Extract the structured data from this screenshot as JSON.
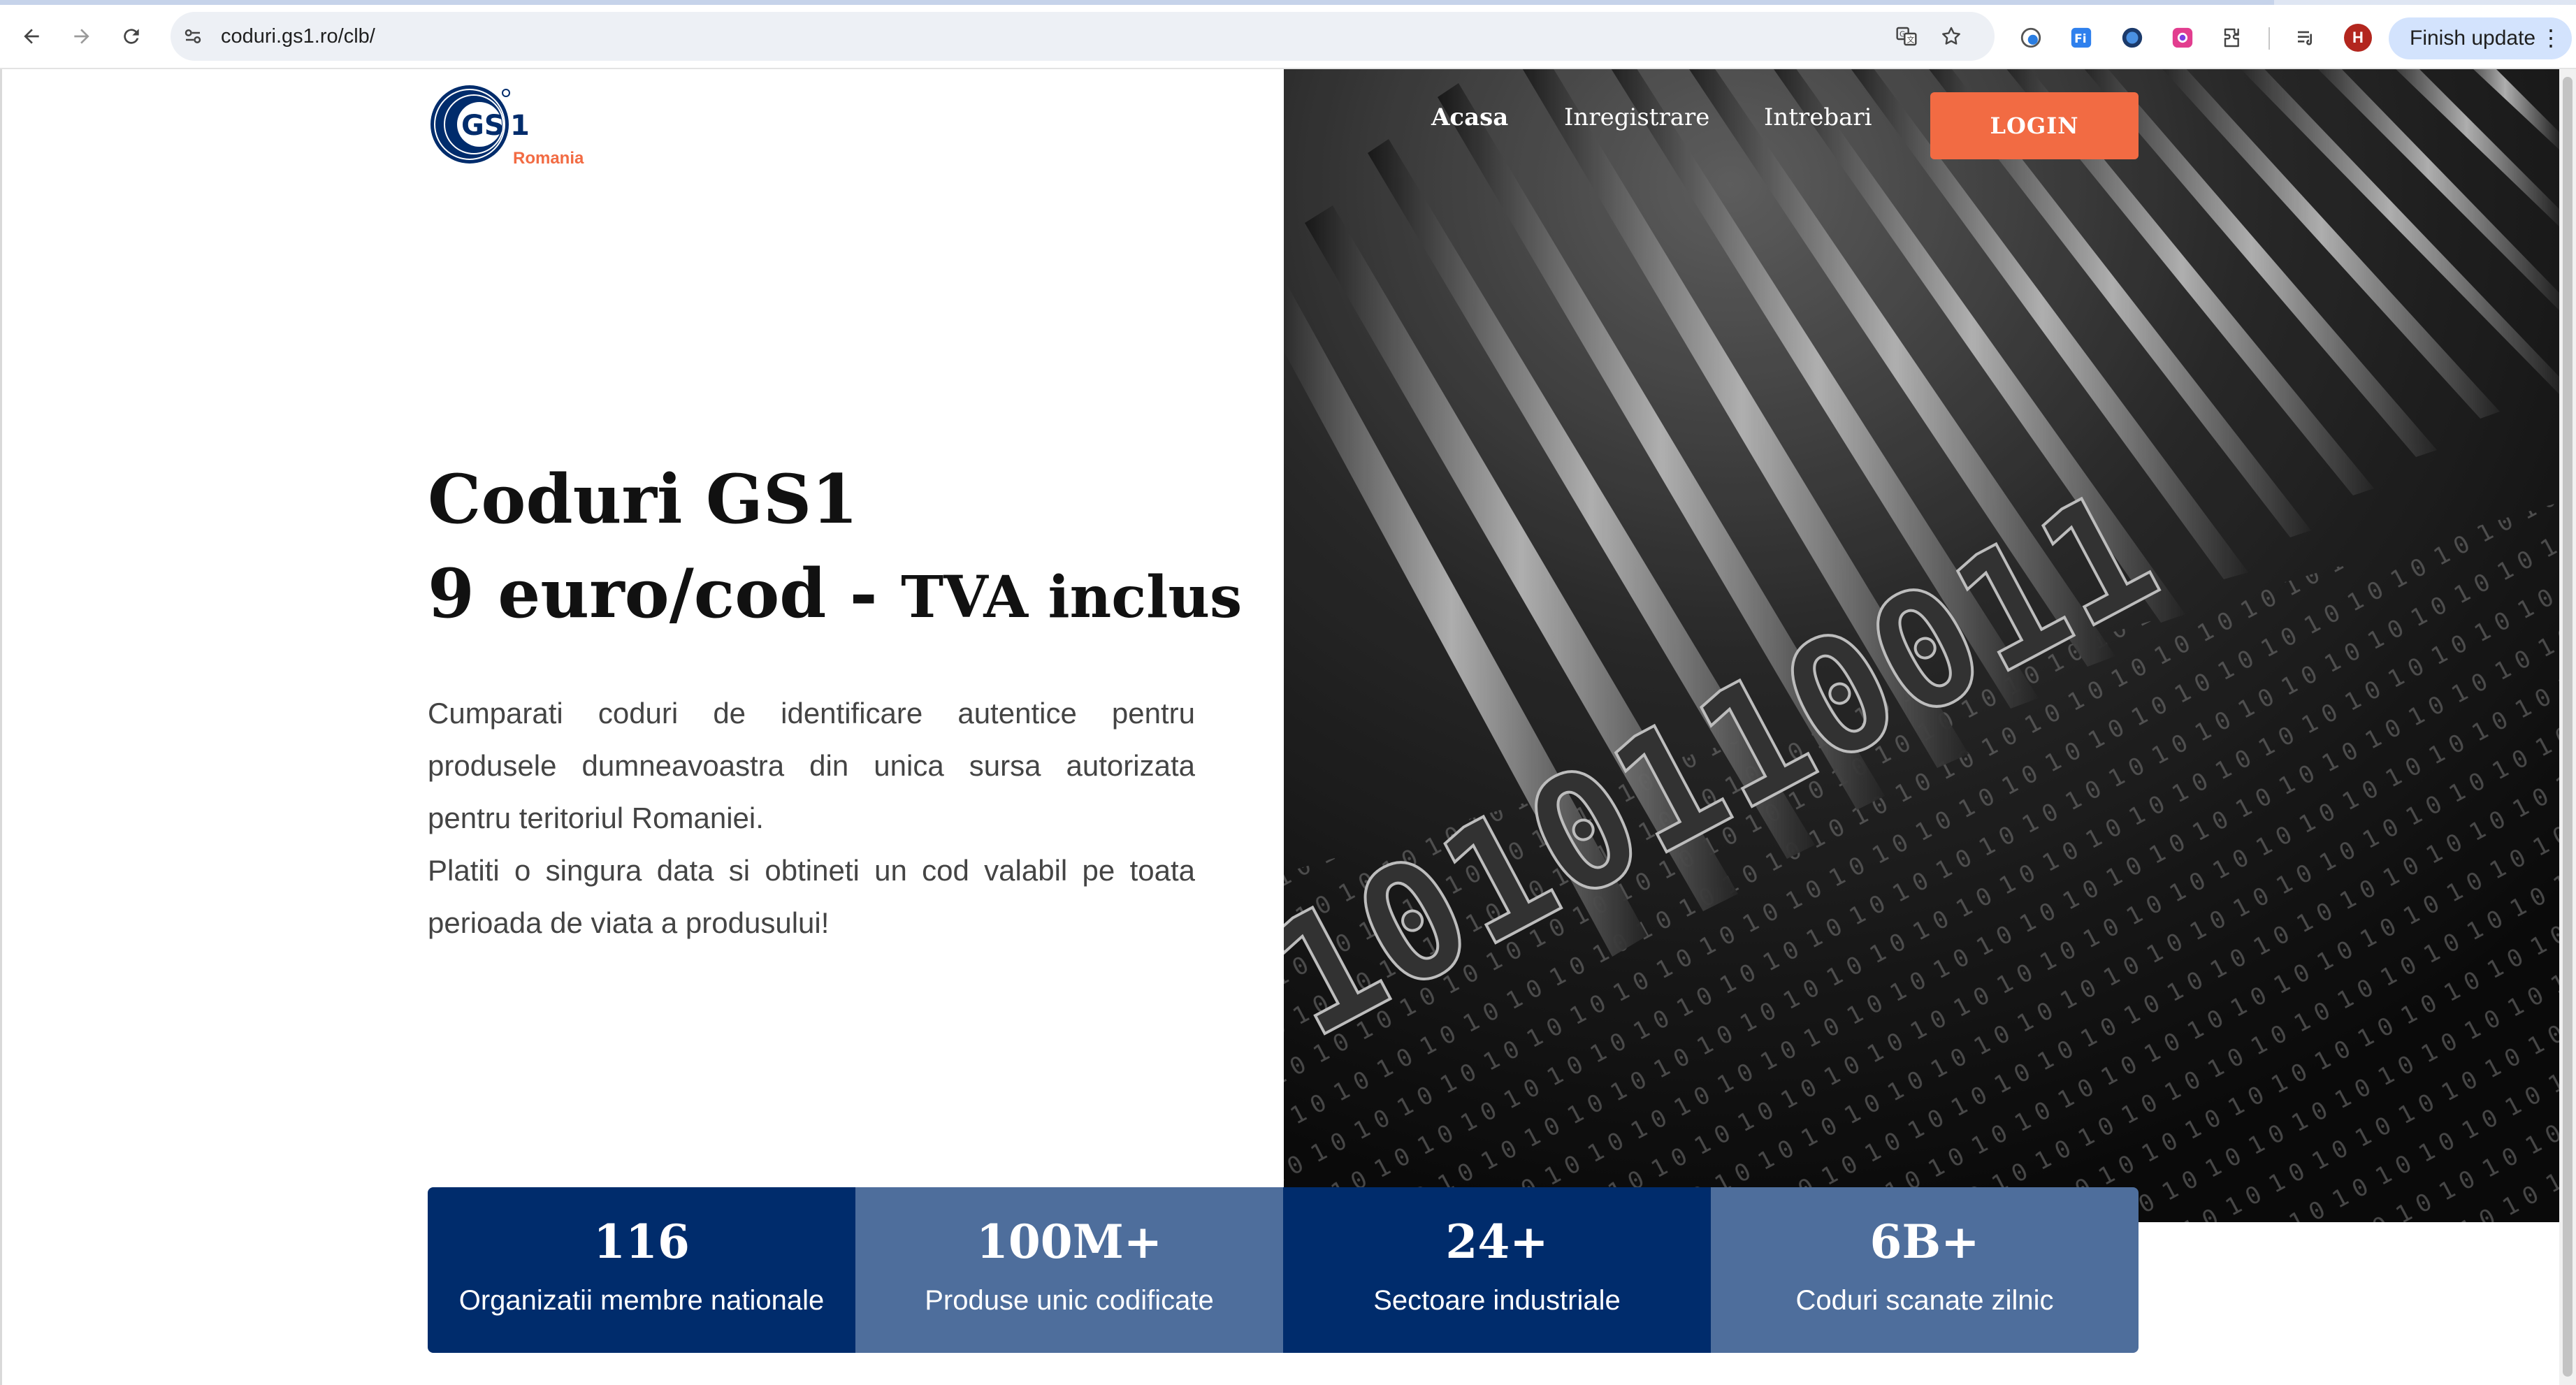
{
  "browser": {
    "url": "coduri.gs1.ro/clb/",
    "avatar_initial": "H",
    "finish_update_label": "Finish update",
    "menu_glyph": "⋮"
  },
  "site": {
    "logo_text": "GS1",
    "logo_country": "Romania",
    "brand_color": "#002c6c",
    "accent_color": "#f26b43",
    "nav": {
      "home": "Acasa",
      "register": "Inregistrare",
      "questions": "Intrebari",
      "login": "LOGIN"
    }
  },
  "hero": {
    "title_line1": "Coduri GS1",
    "title_price": "9 euro/cod -",
    "title_vat": "TVA inclus",
    "paragraph1": "Cumparati coduri de identificare autentice pentru produsele dumneavoastra din unica sursa autorizata pentru teritoriul Romaniei.",
    "paragraph2": "Platiti o singura data si obtineti un cod valabil pe toata perioada de viata a produsului!"
  },
  "stats": [
    {
      "value": "116",
      "label": "Organizatii membre nationale"
    },
    {
      "value": "100M+",
      "label": "Produse unic codificate"
    },
    {
      "value": "24+",
      "label": "Sectoare industriale"
    },
    {
      "value": "6B+",
      "label": "Coduri scanate zilnic"
    }
  ]
}
